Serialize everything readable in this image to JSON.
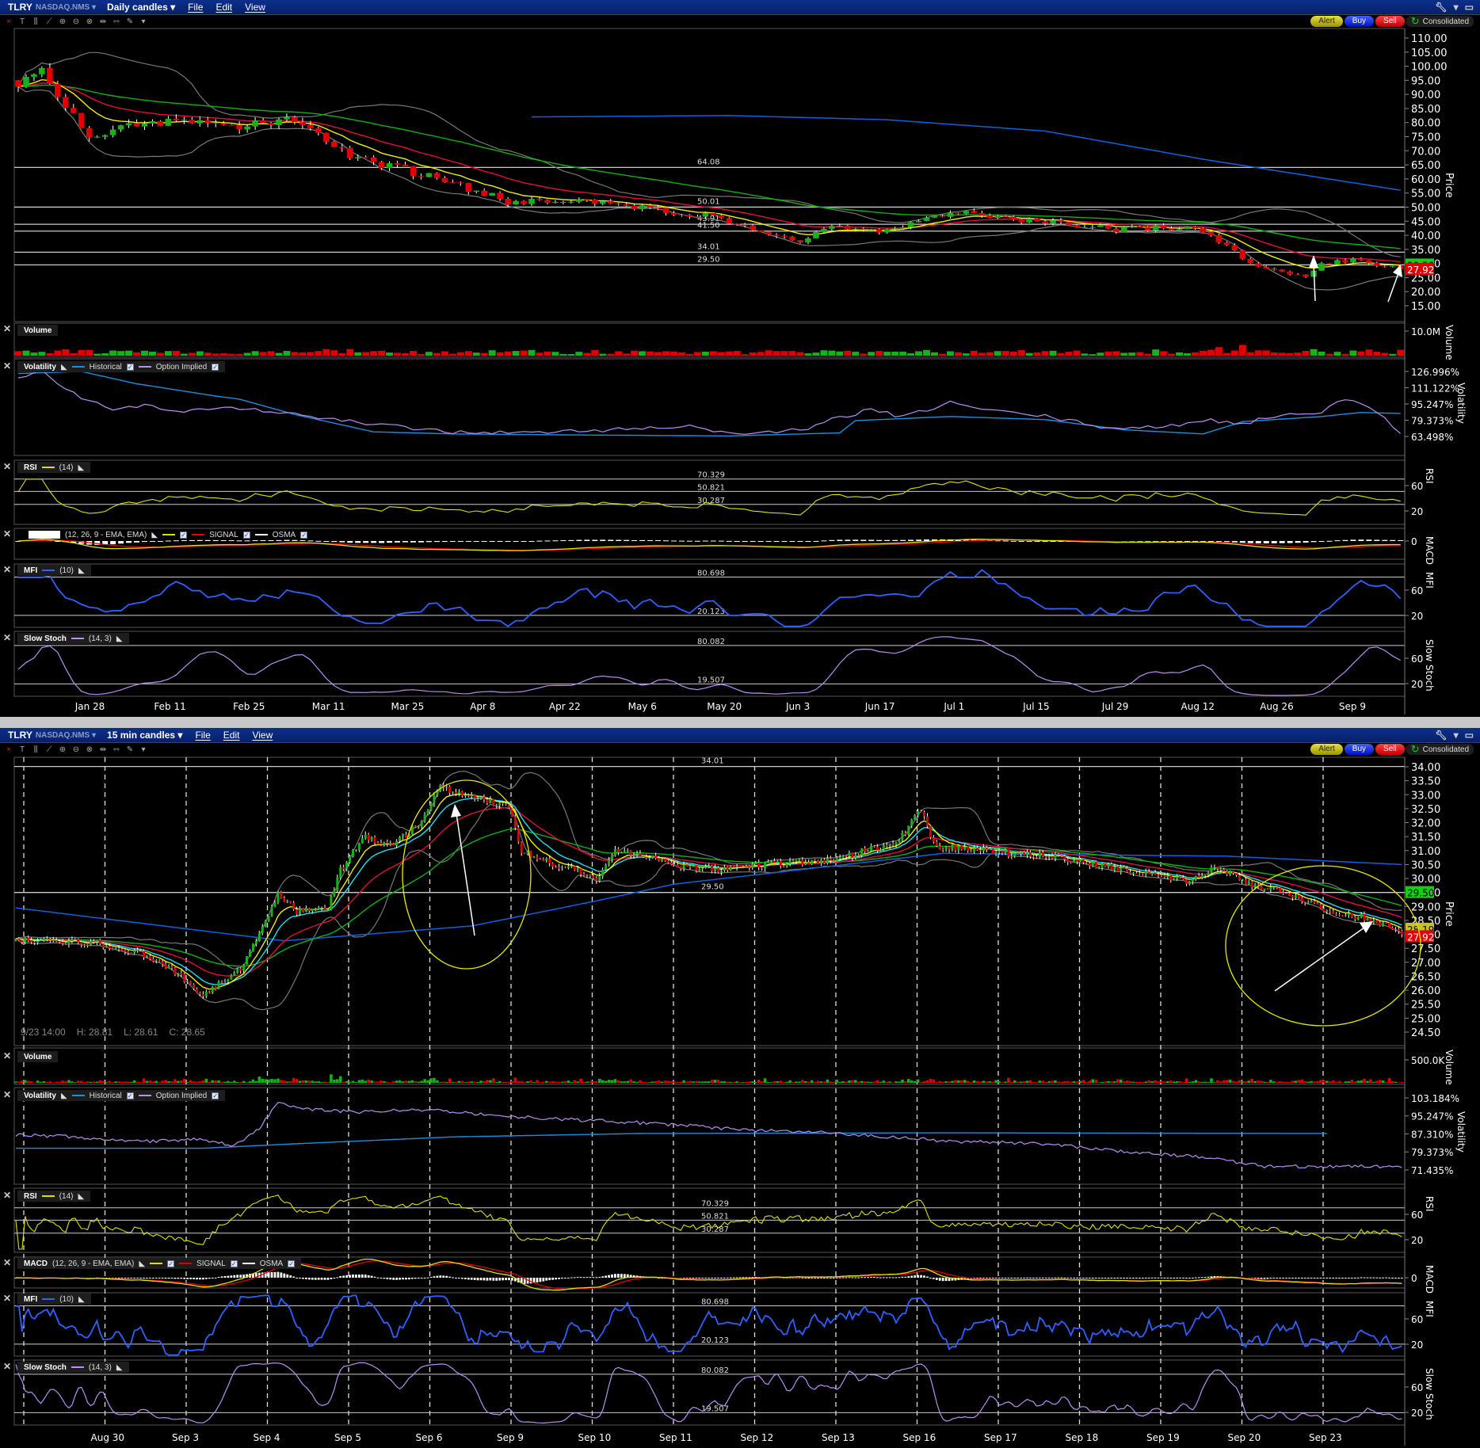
{
  "windows": [
    {
      "symbol": "TLRY",
      "exchange": "NASDAQ.NMS ▾",
      "timeframe": "Daily candles ▾",
      "menus": [
        "File",
        "Edit",
        "View"
      ],
      "buttons": {
        "alert": "Alert",
        "buy": "Buy",
        "sell": "Sell"
      },
      "feed": "Consolidated",
      "panels": {
        "volume": {
          "title": "Volume"
        },
        "volatility": {
          "title": "Volatility",
          "historical": "Historical",
          "implied": "Option Implied"
        },
        "rsi": {
          "title": "RSI",
          "params": "(14)"
        },
        "macd": {
          "title": "",
          "params": "(12, 26, 9 - EMA, EMA)",
          "signal": "SIGNAL",
          "osma": "OSMA"
        },
        "mfi": {
          "title": "MFI",
          "params": "(10)"
        },
        "stoch": {
          "title": "Slow Stoch",
          "params": "(14, 3)"
        }
      }
    },
    {
      "symbol": "TLRY",
      "exchange": "NASDAQ.NMS ▾",
      "timeframe": "15 min candles ▾",
      "menus": [
        "File",
        "Edit",
        "View"
      ],
      "buttons": {
        "alert": "Alert",
        "buy": "Buy",
        "sell": "Sell"
      },
      "feed": "Consolidated",
      "info": {
        "time": "9/23 14:00",
        "high": "H: 28.81",
        "low": "L: 28.61",
        "close": "C: 28.65"
      },
      "panels": {
        "volume": {
          "title": "Volume"
        },
        "volatility": {
          "title": "Volatility",
          "historical": "Historical",
          "implied": "Option Implied"
        },
        "rsi": {
          "title": "RSI",
          "params": "(14)"
        },
        "macd": {
          "title": "MACD",
          "params": "(12, 26, 9 - EMA, EMA)",
          "signal": "SIGNAL",
          "osma": "OSMA"
        },
        "mfi": {
          "title": "MFI",
          "params": "(10)"
        },
        "stoch": {
          "title": "Slow Stoch",
          "params": "(14, 3)"
        }
      }
    }
  ],
  "colors": {
    "up": "#1ab01a",
    "down": "#e00000",
    "ema_fast": "#f0f000",
    "ema_mid": "#e0103a",
    "ema_slow": "#10b010",
    "ema_long": "#1060e0",
    "ema_cyan": "#20e0f0",
    "bands": "#777777",
    "historical": "#1a8fe0",
    "implied": "#b890f0",
    "rsi": "#e0e000",
    "mfi": "#3060ff",
    "stoch": "#b890f0"
  },
  "chart_data": [
    {
      "type": "candlestick",
      "title": "TLRY Daily candles",
      "price_axis_title": "Price",
      "price_ticks": [
        "110.00",
        "105.00",
        "100.00",
        "95.00",
        "90.00",
        "85.00",
        "80.00",
        "75.00",
        "70.00",
        "65.00",
        "60.00",
        "55.00",
        "50.00",
        "45.00",
        "40.00",
        "35.00",
        "30.00",
        "25.00",
        "20.00",
        "15.00"
      ],
      "x_labels": [
        "Jan 28",
        "Feb 11",
        "Feb 25",
        "Mar 11",
        "Mar 25",
        "Apr 8",
        "Apr 22",
        "May 6",
        "May 20",
        "Jun 3",
        "Jun 17",
        "Jul 1",
        "Jul 15",
        "Jul 29",
        "Aug 12",
        "Aug 26",
        "Sep 9"
      ],
      "bars": 176,
      "close_keypoints": [
        [
          0,
          95
        ],
        [
          3,
          100
        ],
        [
          6,
          85
        ],
        [
          9,
          75
        ],
        [
          14,
          78
        ],
        [
          19,
          80
        ],
        [
          29,
          79
        ],
        [
          34,
          82
        ],
        [
          39,
          74
        ],
        [
          42,
          68
        ],
        [
          49,
          63
        ],
        [
          59,
          55
        ],
        [
          62,
          52
        ],
        [
          69,
          52
        ],
        [
          79,
          50
        ],
        [
          89,
          46
        ],
        [
          99,
          37
        ],
        [
          102,
          43
        ],
        [
          109,
          41
        ],
        [
          115,
          46
        ],
        [
          119,
          48
        ],
        [
          129,
          45
        ],
        [
          139,
          42
        ],
        [
          149,
          43
        ],
        [
          153,
          36
        ],
        [
          156,
          30
        ],
        [
          159,
          28
        ],
        [
          163,
          25
        ],
        [
          165,
          30
        ],
        [
          169,
          31
        ],
        [
          175,
          28
        ]
      ],
      "long_ma_keypoints": [
        [
          65,
          82
        ],
        [
          90,
          82.5
        ],
        [
          110,
          81
        ],
        [
          130,
          77
        ],
        [
          150,
          67
        ],
        [
          175,
          56
        ]
      ],
      "levels": [
        {
          "value": 64.08,
          "label": "64.08"
        },
        {
          "value": 50.01,
          "label": "50.01"
        },
        {
          "value": 43.91,
          "label": "43.91"
        },
        {
          "value": 41.5,
          "label": "41.50"
        },
        {
          "value": 34.01,
          "label": "34.01"
        },
        {
          "value": 29.5,
          "label": "29.50"
        }
      ],
      "price_tags": [
        {
          "value": 29.5,
          "label": "29.50",
          "color": "#10d010"
        },
        {
          "value": 27.92,
          "label": "27.92",
          "color": "#e00000"
        }
      ],
      "volume": {
        "axis_title": "Volume",
        "tick": "10.0M",
        "max": 10000000
      },
      "volatility": {
        "axis_title": "Volatility",
        "ticks": [
          "126.996%",
          "111.122%",
          "95.247%",
          "79.373%",
          "63.498%"
        ],
        "implied_keypoints": [
          [
            0,
            120
          ],
          [
            3,
            127
          ],
          [
            8,
            100
          ],
          [
            12,
            90
          ],
          [
            16,
            95
          ],
          [
            20,
            88
          ],
          [
            25,
            92
          ],
          [
            30,
            90
          ],
          [
            35,
            85
          ],
          [
            45,
            75
          ],
          [
            55,
            68
          ],
          [
            65,
            67
          ],
          [
            75,
            70
          ],
          [
            85,
            74
          ],
          [
            90,
            66
          ],
          [
            100,
            70
          ],
          [
            103,
            80
          ],
          [
            108,
            90
          ],
          [
            112,
            82
          ],
          [
            118,
            97
          ],
          [
            122,
            90
          ],
          [
            130,
            83
          ],
          [
            138,
            72
          ],
          [
            145,
            72
          ],
          [
            150,
            80
          ],
          [
            155,
            76
          ],
          [
            160,
            85
          ],
          [
            165,
            88
          ],
          [
            168,
            100
          ],
          [
            172,
            88
          ],
          [
            175,
            68
          ]
        ],
        "historical_keypoints": [
          [
            0,
            125
          ],
          [
            8,
            127
          ],
          [
            15,
            115
          ],
          [
            25,
            103
          ],
          [
            28,
            100
          ],
          [
            35,
            85
          ],
          [
            45,
            68
          ],
          [
            55,
            66
          ],
          [
            70,
            65
          ],
          [
            90,
            64
          ],
          [
            104,
            67
          ],
          [
            106,
            79
          ],
          [
            118,
            83
          ],
          [
            130,
            80
          ],
          [
            140,
            70
          ],
          [
            150,
            66
          ],
          [
            155,
            78
          ],
          [
            165,
            83
          ],
          [
            170,
            87
          ],
          [
            175,
            86
          ]
        ]
      },
      "rsi": {
        "axis_title": "RSI",
        "ticks": [
          "60",
          "20"
        ],
        "levels": [
          "70.329",
          "50.821",
          "30.287"
        ]
      },
      "macd": {
        "axis_title": "MACD",
        "ticks": [
          "0"
        ]
      },
      "mfi": {
        "axis_title": "MFI",
        "ticks": [
          "60",
          "20"
        ],
        "levels": [
          "80.698",
          "20.123"
        ]
      },
      "stoch": {
        "axis_title": "Slow Stoch",
        "ticks": [
          "60",
          "20"
        ],
        "levels": [
          "80.082",
          "19.507"
        ]
      }
    },
    {
      "type": "candlestick",
      "title": "TLRY 15 min candles",
      "price_axis_title": "Price",
      "price_ticks": [
        "34.00",
        "33.50",
        "33.00",
        "32.50",
        "32.00",
        "31.50",
        "31.00",
        "30.50",
        "30.00",
        "29.50",
        "29.00",
        "28.50",
        "28.00",
        "27.50",
        "27.00",
        "26.50",
        "26.00",
        "25.50",
        "25.00",
        "24.50"
      ],
      "x_labels": [
        "Aug 30",
        "Sep 3",
        "Sep 4",
        "Sep 5",
        "Sep 6",
        "Sep 9",
        "Sep 10",
        "Sep 11",
        "Sep 12",
        "Sep 13",
        "Sep 16",
        "Sep 17",
        "Sep 18",
        "Sep 19",
        "Sep 20",
        "Sep 23"
      ],
      "bars": 445,
      "close_keypoints": [
        [
          0,
          27.8
        ],
        [
          26,
          27.7
        ],
        [
          40,
          27.3
        ],
        [
          52,
          26.6
        ],
        [
          60,
          25.8
        ],
        [
          66,
          26.3
        ],
        [
          72,
          26.8
        ],
        [
          78,
          28.0
        ],
        [
          84,
          29.5
        ],
        [
          90,
          28.8
        ],
        [
          100,
          29.0
        ],
        [
          104,
          30.3
        ],
        [
          112,
          31.5
        ],
        [
          120,
          31.2
        ],
        [
          130,
          32.0
        ],
        [
          136,
          33.3
        ],
        [
          150,
          32.8
        ],
        [
          158,
          32.5
        ],
        [
          162,
          31.0
        ],
        [
          170,
          30.6
        ],
        [
          182,
          30.2
        ],
        [
          186,
          30.0
        ],
        [
          192,
          31.0
        ],
        [
          205,
          30.8
        ],
        [
          210,
          30.5
        ],
        [
          225,
          30.3
        ],
        [
          240,
          30.5
        ],
        [
          260,
          30.6
        ],
        [
          272,
          31.0
        ],
        [
          282,
          31.2
        ],
        [
          290,
          32.5
        ],
        [
          294,
          31.2
        ],
        [
          310,
          31.0
        ],
        [
          330,
          30.8
        ],
        [
          345,
          30.5
        ],
        [
          360,
          30.2
        ],
        [
          375,
          29.9
        ],
        [
          385,
          30.4
        ],
        [
          395,
          29.8
        ],
        [
          410,
          29.4
        ],
        [
          420,
          28.8
        ],
        [
          432,
          28.6
        ],
        [
          444,
          28.1
        ]
      ],
      "long_ma_keypoints": [
        [
          0,
          28.95
        ],
        [
          86,
          27.77
        ],
        [
          146,
          28.3
        ],
        [
          186,
          29.2
        ],
        [
          211,
          29.8
        ],
        [
          297,
          30.9
        ],
        [
          388,
          30.8
        ],
        [
          444,
          30.5
        ]
      ],
      "levels": [
        {
          "value": 34.01,
          "label": "34.01"
        },
        {
          "value": 29.5,
          "label": "29.50"
        }
      ],
      "price_tags": [
        {
          "value": 29.5,
          "label": "29.50",
          "color": "#10d010"
        },
        {
          "value": 28.19,
          "label": "28.19",
          "color": "#c8c020"
        },
        {
          "value": 27.92,
          "label": "27.92",
          "color": "#e00000"
        }
      ],
      "volume": {
        "axis_title": "Volume",
        "tick": "500.0K",
        "max": 500000
      },
      "volatility": {
        "axis_title": "Volatility",
        "ticks": [
          "103.184%",
          "95.247%",
          "87.310%",
          "79.373%",
          "71.435%"
        ],
        "implied_keypoints": [
          [
            0,
            87
          ],
          [
            20,
            86
          ],
          [
            40,
            84
          ],
          [
            60,
            85
          ],
          [
            70,
            82
          ],
          [
            78,
            90
          ],
          [
            84,
            101
          ],
          [
            95,
            98
          ],
          [
            110,
            97
          ],
          [
            130,
            98
          ],
          [
            150,
            96
          ],
          [
            170,
            94
          ],
          [
            190,
            93
          ],
          [
            215,
            91
          ],
          [
            235,
            89
          ],
          [
            260,
            88
          ],
          [
            280,
            86
          ],
          [
            300,
            84
          ],
          [
            330,
            83
          ],
          [
            360,
            79
          ],
          [
            380,
            77
          ],
          [
            400,
            73
          ],
          [
            420,
            73
          ],
          [
            444,
            73
          ]
        ],
        "historical_keypoints": [
          [
            0,
            81
          ],
          [
            60,
            81
          ],
          [
            90,
            83
          ],
          [
            140,
            86
          ],
          [
            200,
            87.5
          ],
          [
            300,
            87.8
          ],
          [
            420,
            87.5
          ]
        ]
      },
      "rsi": {
        "axis_title": "RSI",
        "ticks": [
          "60",
          "20"
        ],
        "levels": [
          "70.329",
          "50.821",
          "30.287"
        ]
      },
      "macd": {
        "axis_title": "MACD",
        "ticks": [
          "0"
        ]
      },
      "mfi": {
        "axis_title": "MFI",
        "ticks": [
          "60",
          "20"
        ],
        "levels": [
          "80.698",
          "20.123"
        ]
      },
      "stoch": {
        "axis_title": "Slow Stoch",
        "ticks": [
          "60",
          "20"
        ],
        "levels": [
          "80.082",
          "19.507"
        ]
      }
    }
  ]
}
